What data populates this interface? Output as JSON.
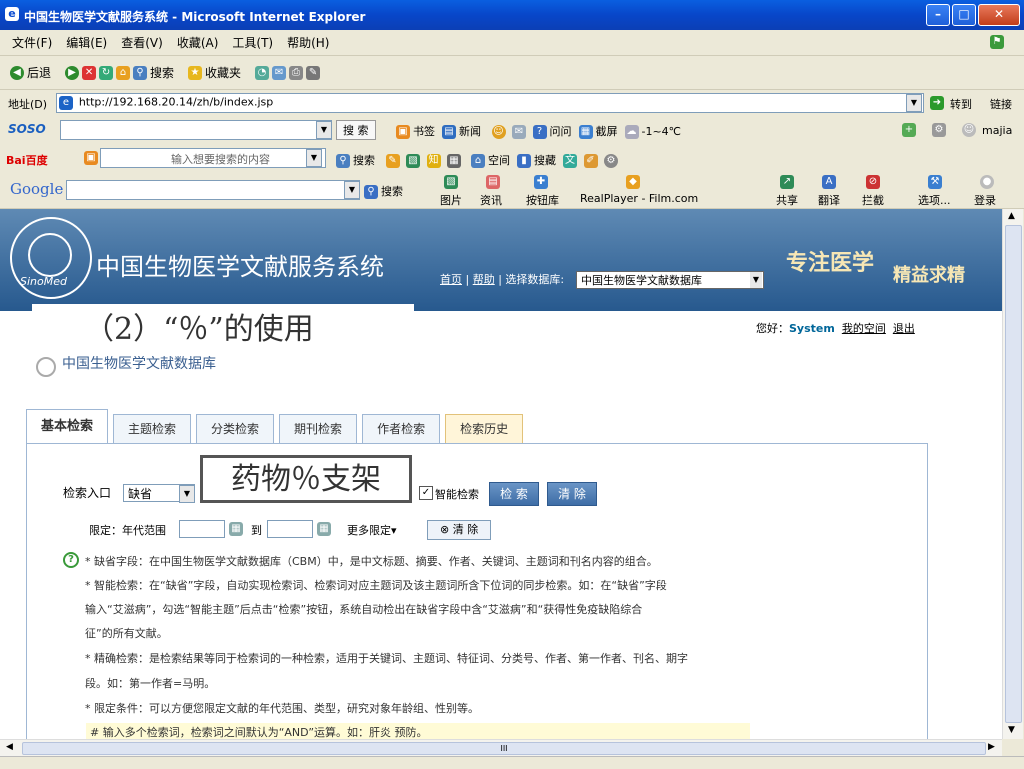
{
  "window": {
    "title": "中国生物医学文献服务系统 - Microsoft Internet Explorer",
    "minimize": "–",
    "maximize": "□",
    "close": "✕"
  },
  "menubar": [
    "文件(F)",
    "编辑(E)",
    "查看(V)",
    "收藏(A)",
    "工具(T)",
    "帮助(H)"
  ],
  "toolbar": {
    "back": "后退",
    "search": "搜索",
    "favorites": "收藏夹"
  },
  "address": {
    "label": "地址(D)",
    "url": "http://192.168.20.14/zh/b/index.jsp",
    "go": "转到",
    "links": "链接"
  },
  "soso": {
    "brand": "SOSO",
    "search_btn": "搜 索",
    "bookmarks": "书签",
    "news": "新闻",
    "ask": "问问",
    "capture": "截屏",
    "weather": "-1~4℃",
    "user": "majia"
  },
  "baidu": {
    "brand": "Bai百度",
    "placeholder": "输入想要搜索的内容",
    "search": "搜索",
    "space": "空间",
    "collect": "搜藏"
  },
  "google": {
    "brand": "Google",
    "search": "搜索",
    "images": "图片",
    "info": "资讯",
    "buttons": "按钮库",
    "realplayer": "RealPlayer - Film.com",
    "share": "共享",
    "translate": "翻译",
    "block": "拦截",
    "options": "选项...",
    "login": "登录"
  },
  "site": {
    "system_name": "中国生物医学文献服务系统",
    "logo_text": "SinoMed",
    "home": "首页",
    "help": "帮助",
    "select_db_label": "选择数据库:",
    "db_value": "中国生物医学文献数据库",
    "slogan1": "专注医学",
    "slogan2": "精益求精",
    "welcome": "您好：",
    "user": "System",
    "my_space": "我的空间",
    "logout": "退出",
    "db_title": "中国生物医学文献数据库"
  },
  "overlay": {
    "heading": "（2）“％”的使用",
    "term": "药物％支架"
  },
  "tabs": [
    "基本检索",
    "主题检索",
    "分类检索",
    "期刊检索",
    "作者检索",
    "检索历史"
  ],
  "form": {
    "entry_label": "检索入口",
    "entry_value": "缺省",
    "smart": "智能检索",
    "search_btn": "检 索",
    "clear_btn": "清 除",
    "limit_label": "限定：年代范围",
    "to": "到",
    "more": "更多限定▾",
    "clear2": "⊗ 清 除"
  },
  "help": [
    "* 缺省字段：在中国生物医学文献数据库（CBM）中，是中文标题、摘要、作者、关键词、主题词和刊名内容的组合。",
    "* 智能检索：在“缺省”字段，自动实现检索词、检索词对应主题词及该主题词所含下位词的同步检索。如：在“缺省”字段",
    "输入“艾滋病”，勾选“智能主题”后点击“检索”按钮，系统自动检出在缺省字段中含“艾滋病”和“获得性免疫缺陷综合",
    "征”的所有文献。",
    "* 精确检索：是检索结果等同于检索词的一种检索，适用于关键词、主题词、特征词、分类号、作者、第一作者、刊名、期字",
    "段。如：第一作者=马明。",
    "* 限定条件：可以方便您限定文献的年代范围、类型，研究对象年龄组、性别等。"
  ],
  "tip": "# 输入多个检索词，检索词之间默认为“AND”运算。如：肝炎 预防。",
  "scroll": {
    "hmark": "III"
  }
}
